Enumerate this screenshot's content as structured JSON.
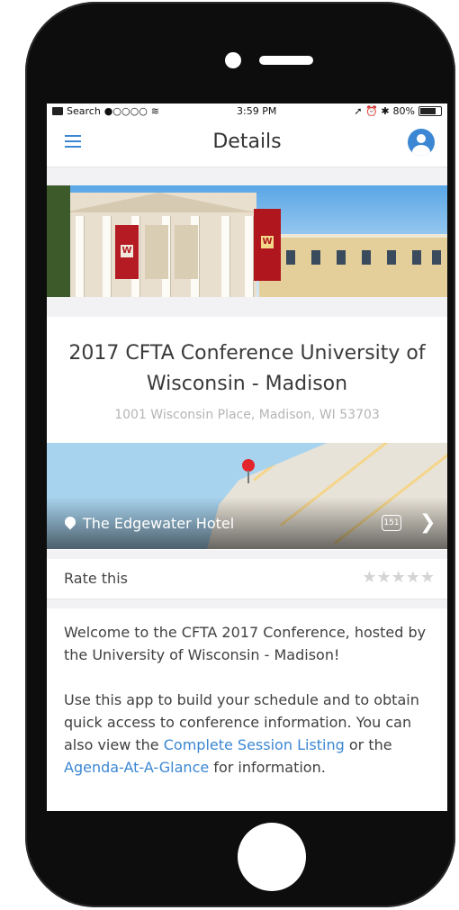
{
  "status_bar": {
    "carrier": "Search",
    "signal": "●○○○○",
    "time": "3:59 PM",
    "indicators": "➚ ⏰ ✱",
    "battery": "80%"
  },
  "nav": {
    "title": "Details",
    "menu_icon": "hamburger-icon",
    "profile_icon": "user-circle-icon"
  },
  "event": {
    "title": "2017 CFTA Conference University of Wisconsin - Madison",
    "address": "1001 Wisconsin Place, Madison, WI 53703"
  },
  "map": {
    "venue": "The Edgewater Hotel",
    "route_shield": "151",
    "chevron": "❯"
  },
  "rating": {
    "label": "Rate this",
    "stars": "★★★★★",
    "value": 0,
    "max": 5
  },
  "description": {
    "paragraph1": "Welcome to the CFTA 2017 Conference, hosted by the University of Wisconsin - Madison!",
    "p2_a": "Use this app to build your schedule and to obtain quick access to conference information. You can also view the ",
    "p2_link1": "Complete Session Listing",
    "p2_b": " or the ",
    "p2_link2": "Agenda-At-A-Glance",
    "p2_c": " for information."
  },
  "colors": {
    "accent": "#3b87d3",
    "banner_red": "#b51b22"
  }
}
